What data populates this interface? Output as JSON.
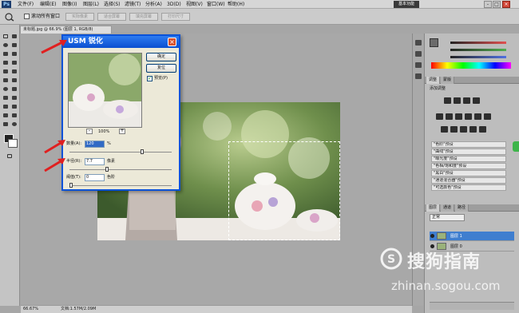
{
  "app": {
    "logo": "Ps",
    "menu": [
      "文件(F)",
      "编辑(E)",
      "图像(I)",
      "图层(L)",
      "选择(S)",
      "滤镜(T)",
      "分析(A)",
      "3D(D)",
      "视图(V)",
      "窗口(W)",
      "帮助(H)"
    ],
    "workspace_label": "基本功能",
    "window_controls": [
      "-",
      "□",
      "×"
    ]
  },
  "options_bar": {
    "checkbox_label": "滚动所有窗口",
    "buttons": [
      "实际像素",
      "适合屏幕",
      "填充屏幕",
      "打印尺寸"
    ]
  },
  "document": {
    "tab_label": "未标题.jpg @ 66.9% (图层 1, RGB/8)",
    "zoom": "66.67%",
    "doc_info": "文档:1.57M/2.09M"
  },
  "usm_dialog": {
    "title": "USM 锐化",
    "ok_label": "确定",
    "reset_label": "复位",
    "preview_label": "预览(P)",
    "preview_checked": true,
    "zoom_level": "100%",
    "zoom_out": "-",
    "zoom_in": "+",
    "amount": {
      "label": "数量(A):",
      "value": "120",
      "unit": "%",
      "slider_fraction": 0.72
    },
    "radius": {
      "label": "半径(R):",
      "value": "7.7",
      "unit": "像素",
      "slider_fraction": 0.36
    },
    "threshold": {
      "label": "阈值(T):",
      "value": "0",
      "unit": "色阶",
      "slider_fraction": 0.0
    }
  },
  "panels": {
    "adjustments_tabs": [
      "调整",
      "蒙版"
    ],
    "adjustments_hint": "添加调整",
    "presets": [
      "\"色阶\"预设",
      "\"曲线\"预设",
      "\"曝光度\"预设",
      "\"色相/饱和度\"预设",
      "\"黑白\"预设",
      "\"通道混合器\"预设",
      "\"可选颜色\"预设"
    ],
    "layers_tabs": [
      "图层",
      "通道",
      "路径"
    ],
    "blend_mode": "正常",
    "layers": [
      {
        "name": "图层 1",
        "selected": true
      },
      {
        "name": "图层 0",
        "selected": false
      }
    ],
    "slider_colors": [
      "#e05050",
      "#50b050",
      "#5070e0"
    ]
  },
  "watermark": {
    "brand": "搜狗指南",
    "url": "zhinan.sogou.com"
  },
  "colors": {
    "arrow": "#e02020",
    "dialog_border": "#0a52d8",
    "selected_layer": "#3f7ecf"
  }
}
